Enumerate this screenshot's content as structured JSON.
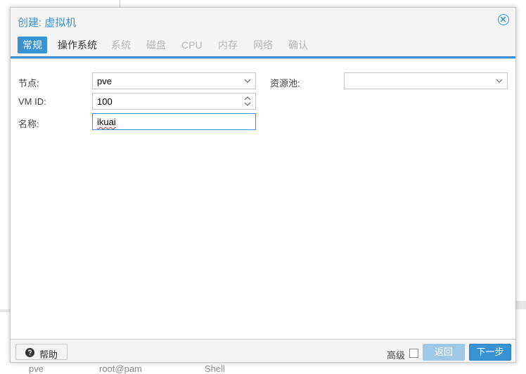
{
  "background": {
    "row": {
      "node": "pve",
      "user": "root@pam",
      "action": "Shell"
    }
  },
  "dialog": {
    "title": "创建: 虚拟机",
    "close_icon": "close-circle-icon"
  },
  "tabs": [
    {
      "label": "常规",
      "state": "active"
    },
    {
      "label": "操作系统",
      "state": "enabled"
    },
    {
      "label": "系统",
      "state": "disabled"
    },
    {
      "label": "磁盘",
      "state": "disabled"
    },
    {
      "label": "CPU",
      "state": "disabled"
    },
    {
      "label": "内存",
      "state": "disabled"
    },
    {
      "label": "网络",
      "state": "disabled"
    },
    {
      "label": "确认",
      "state": "disabled"
    }
  ],
  "form": {
    "node": {
      "label": "节点:",
      "value": "pve"
    },
    "vmid": {
      "label": "VM ID:",
      "value": "100"
    },
    "name": {
      "label": "名称:",
      "value": "ikuai"
    },
    "pool": {
      "label": "资源池:",
      "value": ""
    }
  },
  "footer": {
    "help_label": "帮助",
    "advanced_label": "高级",
    "advanced_checked": false,
    "back_label": "返回",
    "next_label": "下一步"
  },
  "colors": {
    "accent": "#3892d4",
    "disabled_button": "#9fc8e6",
    "disabled_tab_text": "#b4b4b4"
  }
}
